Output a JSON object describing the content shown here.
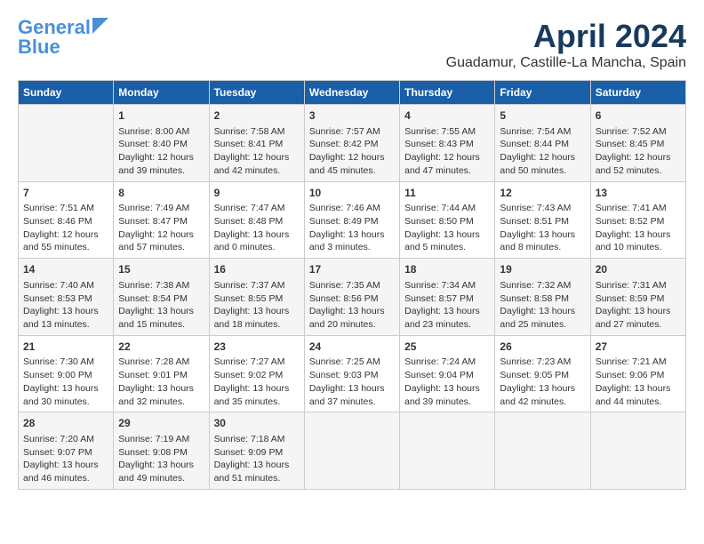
{
  "header": {
    "logo_line1": "General",
    "logo_line2": "Blue",
    "title": "April 2024",
    "subtitle": "Guadamur, Castille-La Mancha, Spain"
  },
  "days_of_week": [
    "Sunday",
    "Monday",
    "Tuesday",
    "Wednesday",
    "Thursday",
    "Friday",
    "Saturday"
  ],
  "weeks": [
    [
      {
        "day": "",
        "content": ""
      },
      {
        "day": "1",
        "content": "Sunrise: 8:00 AM\nSunset: 8:40 PM\nDaylight: 12 hours\nand 39 minutes."
      },
      {
        "day": "2",
        "content": "Sunrise: 7:58 AM\nSunset: 8:41 PM\nDaylight: 12 hours\nand 42 minutes."
      },
      {
        "day": "3",
        "content": "Sunrise: 7:57 AM\nSunset: 8:42 PM\nDaylight: 12 hours\nand 45 minutes."
      },
      {
        "day": "4",
        "content": "Sunrise: 7:55 AM\nSunset: 8:43 PM\nDaylight: 12 hours\nand 47 minutes."
      },
      {
        "day": "5",
        "content": "Sunrise: 7:54 AM\nSunset: 8:44 PM\nDaylight: 12 hours\nand 50 minutes."
      },
      {
        "day": "6",
        "content": "Sunrise: 7:52 AM\nSunset: 8:45 PM\nDaylight: 12 hours\nand 52 minutes."
      }
    ],
    [
      {
        "day": "7",
        "content": "Sunrise: 7:51 AM\nSunset: 8:46 PM\nDaylight: 12 hours\nand 55 minutes."
      },
      {
        "day": "8",
        "content": "Sunrise: 7:49 AM\nSunset: 8:47 PM\nDaylight: 12 hours\nand 57 minutes."
      },
      {
        "day": "9",
        "content": "Sunrise: 7:47 AM\nSunset: 8:48 PM\nDaylight: 13 hours\nand 0 minutes."
      },
      {
        "day": "10",
        "content": "Sunrise: 7:46 AM\nSunset: 8:49 PM\nDaylight: 13 hours\nand 3 minutes."
      },
      {
        "day": "11",
        "content": "Sunrise: 7:44 AM\nSunset: 8:50 PM\nDaylight: 13 hours\nand 5 minutes."
      },
      {
        "day": "12",
        "content": "Sunrise: 7:43 AM\nSunset: 8:51 PM\nDaylight: 13 hours\nand 8 minutes."
      },
      {
        "day": "13",
        "content": "Sunrise: 7:41 AM\nSunset: 8:52 PM\nDaylight: 13 hours\nand 10 minutes."
      }
    ],
    [
      {
        "day": "14",
        "content": "Sunrise: 7:40 AM\nSunset: 8:53 PM\nDaylight: 13 hours\nand 13 minutes."
      },
      {
        "day": "15",
        "content": "Sunrise: 7:38 AM\nSunset: 8:54 PM\nDaylight: 13 hours\nand 15 minutes."
      },
      {
        "day": "16",
        "content": "Sunrise: 7:37 AM\nSunset: 8:55 PM\nDaylight: 13 hours\nand 18 minutes."
      },
      {
        "day": "17",
        "content": "Sunrise: 7:35 AM\nSunset: 8:56 PM\nDaylight: 13 hours\nand 20 minutes."
      },
      {
        "day": "18",
        "content": "Sunrise: 7:34 AM\nSunset: 8:57 PM\nDaylight: 13 hours\nand 23 minutes."
      },
      {
        "day": "19",
        "content": "Sunrise: 7:32 AM\nSunset: 8:58 PM\nDaylight: 13 hours\nand 25 minutes."
      },
      {
        "day": "20",
        "content": "Sunrise: 7:31 AM\nSunset: 8:59 PM\nDaylight: 13 hours\nand 27 minutes."
      }
    ],
    [
      {
        "day": "21",
        "content": "Sunrise: 7:30 AM\nSunset: 9:00 PM\nDaylight: 13 hours\nand 30 minutes."
      },
      {
        "day": "22",
        "content": "Sunrise: 7:28 AM\nSunset: 9:01 PM\nDaylight: 13 hours\nand 32 minutes."
      },
      {
        "day": "23",
        "content": "Sunrise: 7:27 AM\nSunset: 9:02 PM\nDaylight: 13 hours\nand 35 minutes."
      },
      {
        "day": "24",
        "content": "Sunrise: 7:25 AM\nSunset: 9:03 PM\nDaylight: 13 hours\nand 37 minutes."
      },
      {
        "day": "25",
        "content": "Sunrise: 7:24 AM\nSunset: 9:04 PM\nDaylight: 13 hours\nand 39 minutes."
      },
      {
        "day": "26",
        "content": "Sunrise: 7:23 AM\nSunset: 9:05 PM\nDaylight: 13 hours\nand 42 minutes."
      },
      {
        "day": "27",
        "content": "Sunrise: 7:21 AM\nSunset: 9:06 PM\nDaylight: 13 hours\nand 44 minutes."
      }
    ],
    [
      {
        "day": "28",
        "content": "Sunrise: 7:20 AM\nSunset: 9:07 PM\nDaylight: 13 hours\nand 46 minutes."
      },
      {
        "day": "29",
        "content": "Sunrise: 7:19 AM\nSunset: 9:08 PM\nDaylight: 13 hours\nand 49 minutes."
      },
      {
        "day": "30",
        "content": "Sunrise: 7:18 AM\nSunset: 9:09 PM\nDaylight: 13 hours\nand 51 minutes."
      },
      {
        "day": "",
        "content": ""
      },
      {
        "day": "",
        "content": ""
      },
      {
        "day": "",
        "content": ""
      },
      {
        "day": "",
        "content": ""
      }
    ]
  ]
}
